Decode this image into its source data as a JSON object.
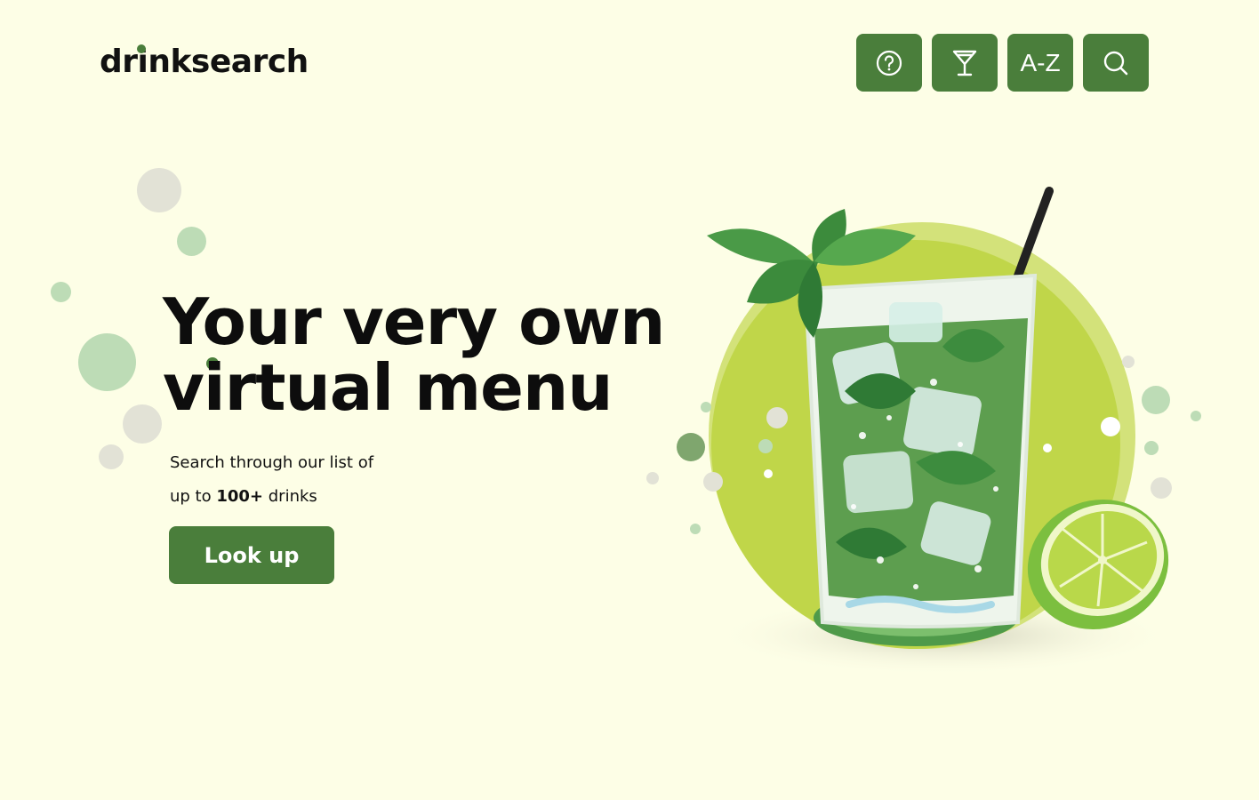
{
  "brand": {
    "name": "drinksearch",
    "accent": "#4a7e3b",
    "background": "#fdfee6"
  },
  "nav": {
    "help": {
      "icon": "question-circle-icon"
    },
    "cocktails": {
      "icon": "cocktail-glass-icon"
    },
    "az": {
      "label": "A-Z"
    },
    "search": {
      "icon": "search-icon"
    }
  },
  "hero": {
    "title_line1": "Your very own",
    "title_line2": "virtual menu",
    "subtitle_line1": "Search through our list of",
    "subtitle_line2_pre": "up to ",
    "subtitle_line2_bold": "100+",
    "subtitle_line2_post": " drinks",
    "cta_label": "Look up"
  }
}
